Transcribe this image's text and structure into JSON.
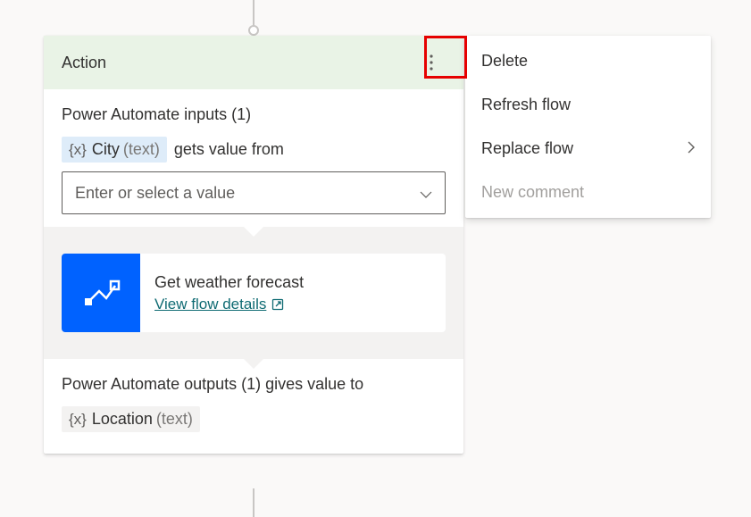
{
  "card": {
    "header_title": "Action",
    "inputs_title": "Power Automate inputs (1)",
    "input_variable": {
      "brace": "{x}",
      "name": "City",
      "type": "(text)"
    },
    "gets_value_from": "gets value from",
    "select_placeholder": "Enter or select a value",
    "flow": {
      "title": "Get weather forecast",
      "link_text": "View flow details"
    },
    "outputs_title": "Power Automate outputs (1) gives value to",
    "output_variable": {
      "brace": "{x}",
      "name": "Location",
      "type": "(text)"
    }
  },
  "menu": {
    "items": [
      {
        "label": "Delete",
        "submenu": false,
        "disabled": false
      },
      {
        "label": "Refresh flow",
        "submenu": false,
        "disabled": false
      },
      {
        "label": "Replace flow",
        "submenu": true,
        "disabled": false
      },
      {
        "label": "New comment",
        "submenu": false,
        "disabled": true
      }
    ]
  }
}
